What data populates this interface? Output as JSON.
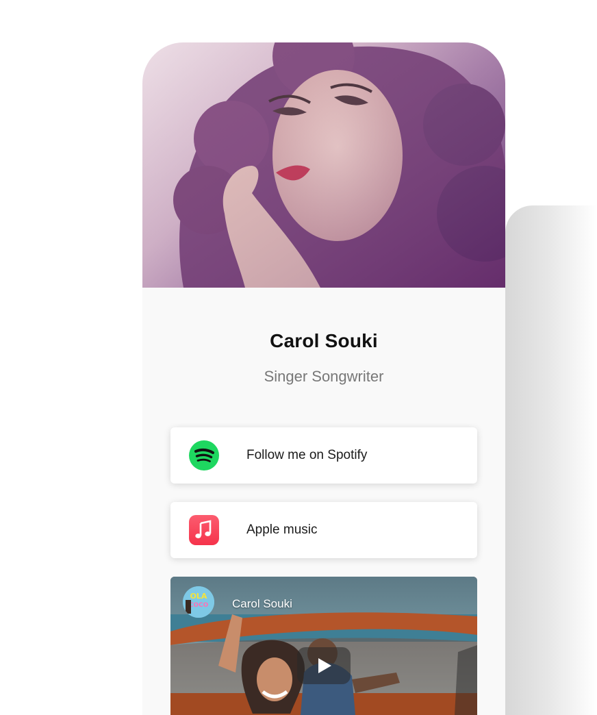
{
  "profile": {
    "name": "Carol Souki",
    "subtitle": "Singer Songwriter"
  },
  "links": [
    {
      "label": "Follow me on Spotify",
      "icon": "spotify-icon",
      "color": "#1ED760"
    },
    {
      "label": "Apple music",
      "icon": "apple-music-icon",
      "color": "#FA3A57"
    }
  ],
  "video": {
    "channel_name": "Carol Souki",
    "avatar_text": "OLA COCO"
  },
  "colors": {
    "background": "#F9F9F9",
    "spotify": "#1ED760",
    "apple_music": "#FA3A57",
    "hero_tint": "#6A3A7A"
  }
}
